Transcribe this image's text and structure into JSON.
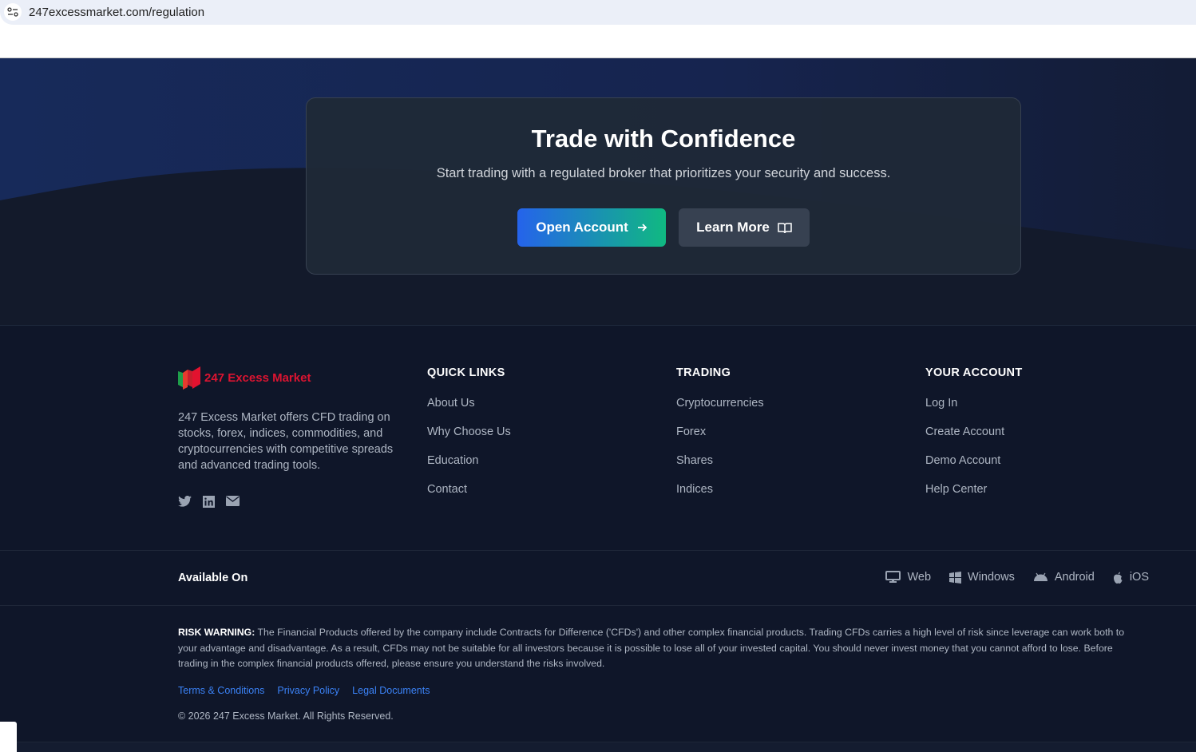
{
  "browser": {
    "url": "247excessmarket.com/regulation"
  },
  "cta": {
    "title": "Trade with Confidence",
    "subtitle": "Start trading with a regulated broker that prioritizes your security and success.",
    "open_account": "Open Account",
    "learn_more": "Learn More"
  },
  "footer": {
    "brand": "247 Excess Market",
    "about": "247 Excess Market offers CFD trading on stocks, forex, indices, commodities, and cryptocurrencies with competitive spreads and advanced trading tools.",
    "columns": [
      {
        "title": "QUICK LINKS",
        "links": [
          "About Us",
          "Why Choose Us",
          "Education",
          "Contact"
        ]
      },
      {
        "title": "TRADING",
        "links": [
          "Cryptocurrencies",
          "Forex",
          "Shares",
          "Indices"
        ]
      },
      {
        "title": "YOUR ACCOUNT",
        "links": [
          "Log In",
          "Create Account",
          "Demo Account",
          "Help Center"
        ]
      }
    ],
    "available_on": "Available On",
    "platforms": [
      "Web",
      "Windows",
      "Android",
      "iOS"
    ],
    "risk_label": "RISK WARNING:",
    "risk_text": " The Financial Products offered by the company include Contracts for Difference ('CFDs') and other complex financial products. Trading CFDs carries a high level of risk since leverage can work both to your advantage and disadvantage. As a result, CFDs may not be suitable for all investors because it is possible to lose all of your invested capital. You should never invest money that you cannot afford to lose. Before trading in the complex financial products offered, please ensure you understand the risks involved.",
    "legal_links": [
      "Terms & Conditions",
      "Privacy Policy",
      "Legal Documents"
    ],
    "copyright": "© 2026 247 Excess Market. All Rights Reserved."
  }
}
